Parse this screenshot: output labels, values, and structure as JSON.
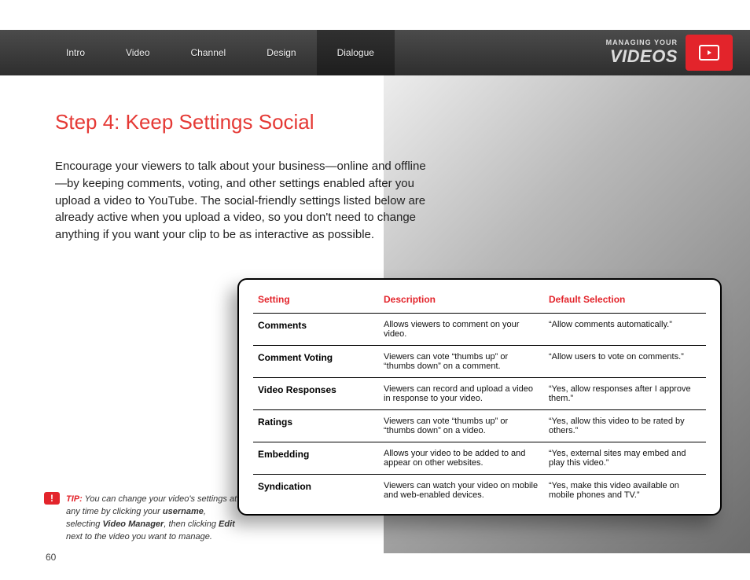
{
  "nav": {
    "tabs": [
      "Intro",
      "Video",
      "Channel",
      "Design",
      "Dialogue"
    ],
    "active_index": 4,
    "brand_small": "MANAGING YOUR",
    "brand_big": "VIDEOS"
  },
  "main": {
    "heading": "Step 4: Keep Settings Social",
    "paragraph": "Encourage your viewers to talk about your business—online and offline—by keeping comments, voting, and other settings enabled after you upload a video to YouTube. The social-friendly settings listed below are already active when you upload a video, so you don't need to change anything if you want your clip to be as interactive as possible."
  },
  "table": {
    "headers": {
      "setting": "Setting",
      "description": "Description",
      "default": "Default Selection"
    },
    "rows": [
      {
        "setting": "Comments",
        "description": "Allows viewers to comment on your video.",
        "default": "“Allow comments automatically.”"
      },
      {
        "setting": "Comment Voting",
        "description": "Viewers can vote “thumbs up” or “thumbs down” on a comment.",
        "default": "“Allow users to vote on comments.”"
      },
      {
        "setting": "Video Responses",
        "description": "Viewers can record and upload a video in response to your video.",
        "default": "“Yes, allow responses after I approve them.”"
      },
      {
        "setting": "Ratings",
        "description": "Viewers can vote “thumbs up” or “thumbs down” on a video.",
        "default": "“Yes, allow this video to be rated by others.”"
      },
      {
        "setting": "Embedding",
        "description": "Allows your video to be added to and appear on other websites.",
        "default": "“Yes, external sites may embed and play this video.”"
      },
      {
        "setting": "Syndication",
        "description": "Viewers can watch your video on mobile and web-enabled devices.",
        "default": "“Yes, make this video available on mobile phones and TV.”"
      }
    ]
  },
  "tip": {
    "label": "TIP:",
    "text_pre": " You can change your video's settings at any time by clicking your ",
    "bold1": "username",
    "text_mid1": ", selecting ",
    "bold2": "Video Manager",
    "text_mid2": ", then clicking ",
    "bold3": "Edit",
    "text_post": " next to the video you want to manage."
  },
  "page_number": "60"
}
